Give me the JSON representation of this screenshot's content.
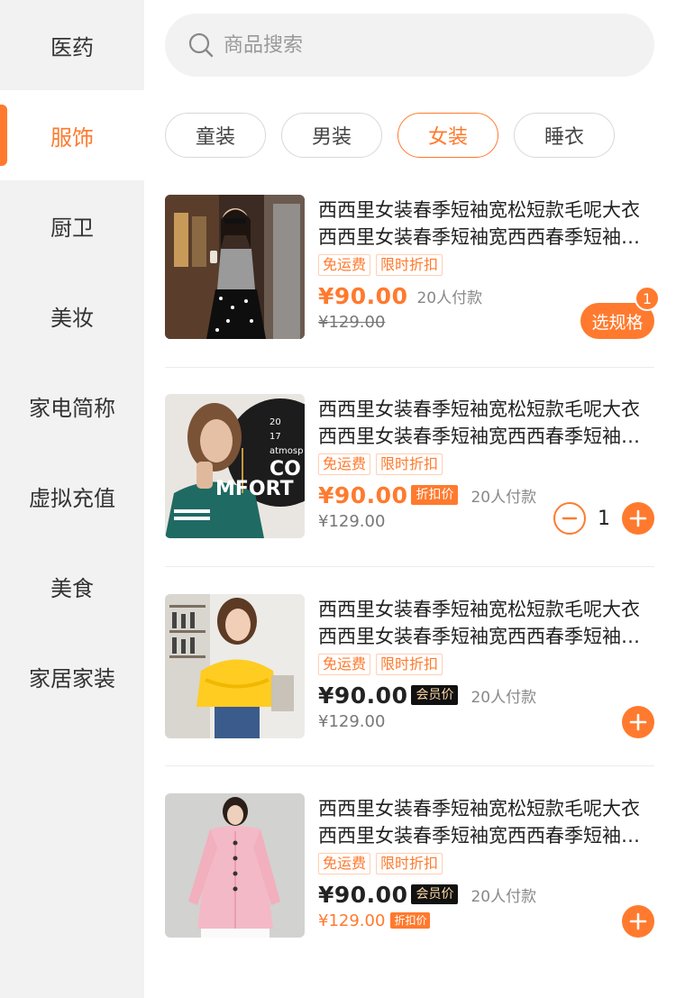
{
  "sidebar": {
    "items": [
      {
        "label": "医药"
      },
      {
        "label": "服饰"
      },
      {
        "label": "厨卫"
      },
      {
        "label": "美妆"
      },
      {
        "label": "家电简称"
      },
      {
        "label": "虚拟充值"
      },
      {
        "label": "美食"
      },
      {
        "label": "家居家装"
      }
    ],
    "active_index": 1
  },
  "search": {
    "placeholder": "商品搜索",
    "value": ""
  },
  "chips": [
    {
      "label": "童装"
    },
    {
      "label": "男装"
    },
    {
      "label": "女装"
    },
    {
      "label": "睡衣"
    }
  ],
  "colors": {
    "accent": "#ff7a2e",
    "sidebar_bg": "#f2f2f2"
  },
  "products": [
    {
      "title1": "西西里女装春季短袖宽松短款毛呢大衣",
      "title2": "西西里女装春季短袖宽西西春季短袖宽松短款",
      "tag1": "免运费",
      "tag2": "限时折扣",
      "price": "¥90.00",
      "paid": "20人付款",
      "orig": "¥129.00",
      "spec_label": "选规格",
      "spec_count": "1"
    },
    {
      "title1": "西西里女装春季短袖宽松短款毛呢大衣",
      "title2": "西西里女装春季短袖宽西西春季短袖宽松短款",
      "tag1": "免运费",
      "tag2": "限时折扣",
      "price": "¥90.00",
      "badge": "折扣价",
      "paid": "20人付款",
      "orig": "¥129.00",
      "qty": "1",
      "image_text1": "20",
      "image_text2": "17",
      "image_text3": "atmosp",
      "image_text4": "CO",
      "image_text5": "MFORT"
    },
    {
      "title1": "西西里女装春季短袖宽松短款毛呢大衣",
      "title2": "西西里女装春季短袖宽西西春季短袖宽松短款",
      "tag1": "免运费",
      "tag2": "限时折扣",
      "price": "¥90.00",
      "badge": "会员价",
      "paid": "20人付款",
      "orig": "¥129.00"
    },
    {
      "title1": "西西里女装春季短袖宽松短款毛呢大衣",
      "title2": "西西里女装春季短袖宽西西春季短袖宽松短款",
      "tag1": "免运费",
      "tag2": "限时折扣",
      "price": "¥90.00",
      "badge": "会员价",
      "paid": "20人付款",
      "orig": "¥129.00",
      "orig_badge": "折扣价"
    }
  ]
}
